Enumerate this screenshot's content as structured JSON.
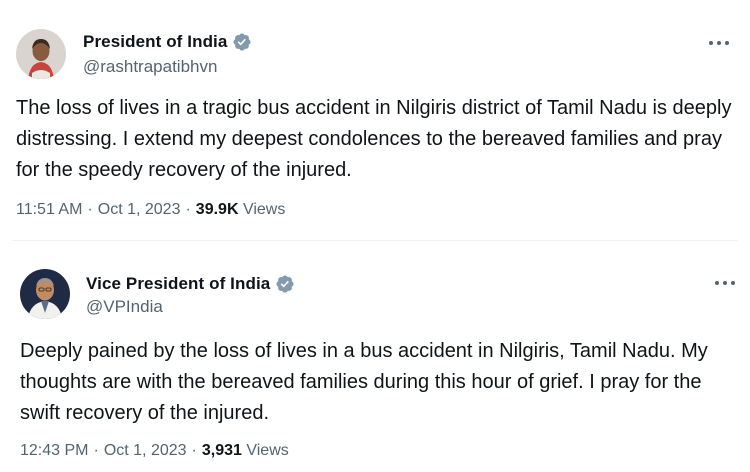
{
  "tweets": [
    {
      "name": "President of India",
      "handle": "@rashtrapatibhvn",
      "text": "The loss of lives in a tragic bus accident in Nilgiris district of Tamil Nadu is deeply distressing. I extend my deepest condolences to the bereaved families and pray for the speedy recovery of the injured.",
      "time": "11:51 AM",
      "date": "Oct 1, 2023",
      "views_count": "39.9K",
      "views_label": "Views",
      "verified_icon": "verified-badge-icon",
      "more_icon": "more-options-icon"
    },
    {
      "name": "Vice President of India",
      "handle": "@VPIndia",
      "text": "Deeply pained by the loss of lives in a bus accident in Nilgiris, Tamil Nadu. My thoughts are with the bereaved families during this hour of grief. I pray for the swift recovery of the injured.",
      "time": "12:43 PM",
      "date": "Oct 1, 2023",
      "views_count": "3,931",
      "views_label": "Views",
      "verified_icon": "verified-badge-icon",
      "more_icon": "more-options-icon"
    }
  ],
  "separator": "·",
  "colors": {
    "verified": "#829aab",
    "text": "#0f1419",
    "secondary": "#536471"
  }
}
